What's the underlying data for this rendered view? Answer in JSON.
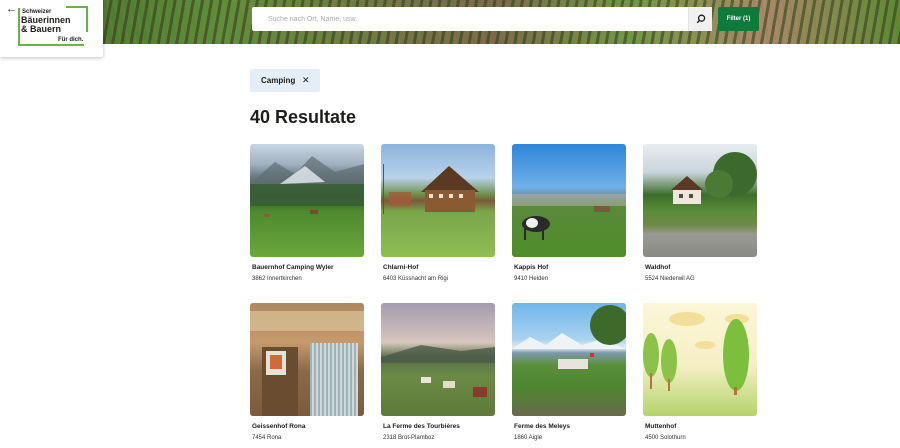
{
  "header": {
    "back_icon": "arrow-left-icon",
    "logo": {
      "line1": "Schweizer",
      "line2": "Bäuerinnen",
      "line3": "& Bauern",
      "tagline": "Für dich."
    },
    "search": {
      "placeholder": "Suche nach Ort, Name, usw.",
      "value": "",
      "icon": "search-icon"
    },
    "filter_label": "Filter (1)",
    "accent_color": "#0e7a3c"
  },
  "active_filter": {
    "label": "Camping",
    "close_symbol": "✕"
  },
  "results": {
    "title": "40 Resultate",
    "items": [
      {
        "name": "Bauernhof Camping Wyler",
        "location": "3862 Innertkirchen"
      },
      {
        "name": "Chlarni-Hof",
        "location": "6403 Küssnacht am Rigi"
      },
      {
        "name": "Kappis Hof",
        "location": "9410 Heiden"
      },
      {
        "name": "Waldhof",
        "location": "5524 Niederwil AG"
      },
      {
        "name": "Geissenhof Rona",
        "location": "7454 Rona"
      },
      {
        "name": "La Ferme des Tourbières",
        "location": "2318 Brot-Plamboz"
      },
      {
        "name": "Ferme des Meleys",
        "location": "1860 Aigle"
      },
      {
        "name": "Muttenhof",
        "location": "4500 Solothurn"
      }
    ]
  }
}
